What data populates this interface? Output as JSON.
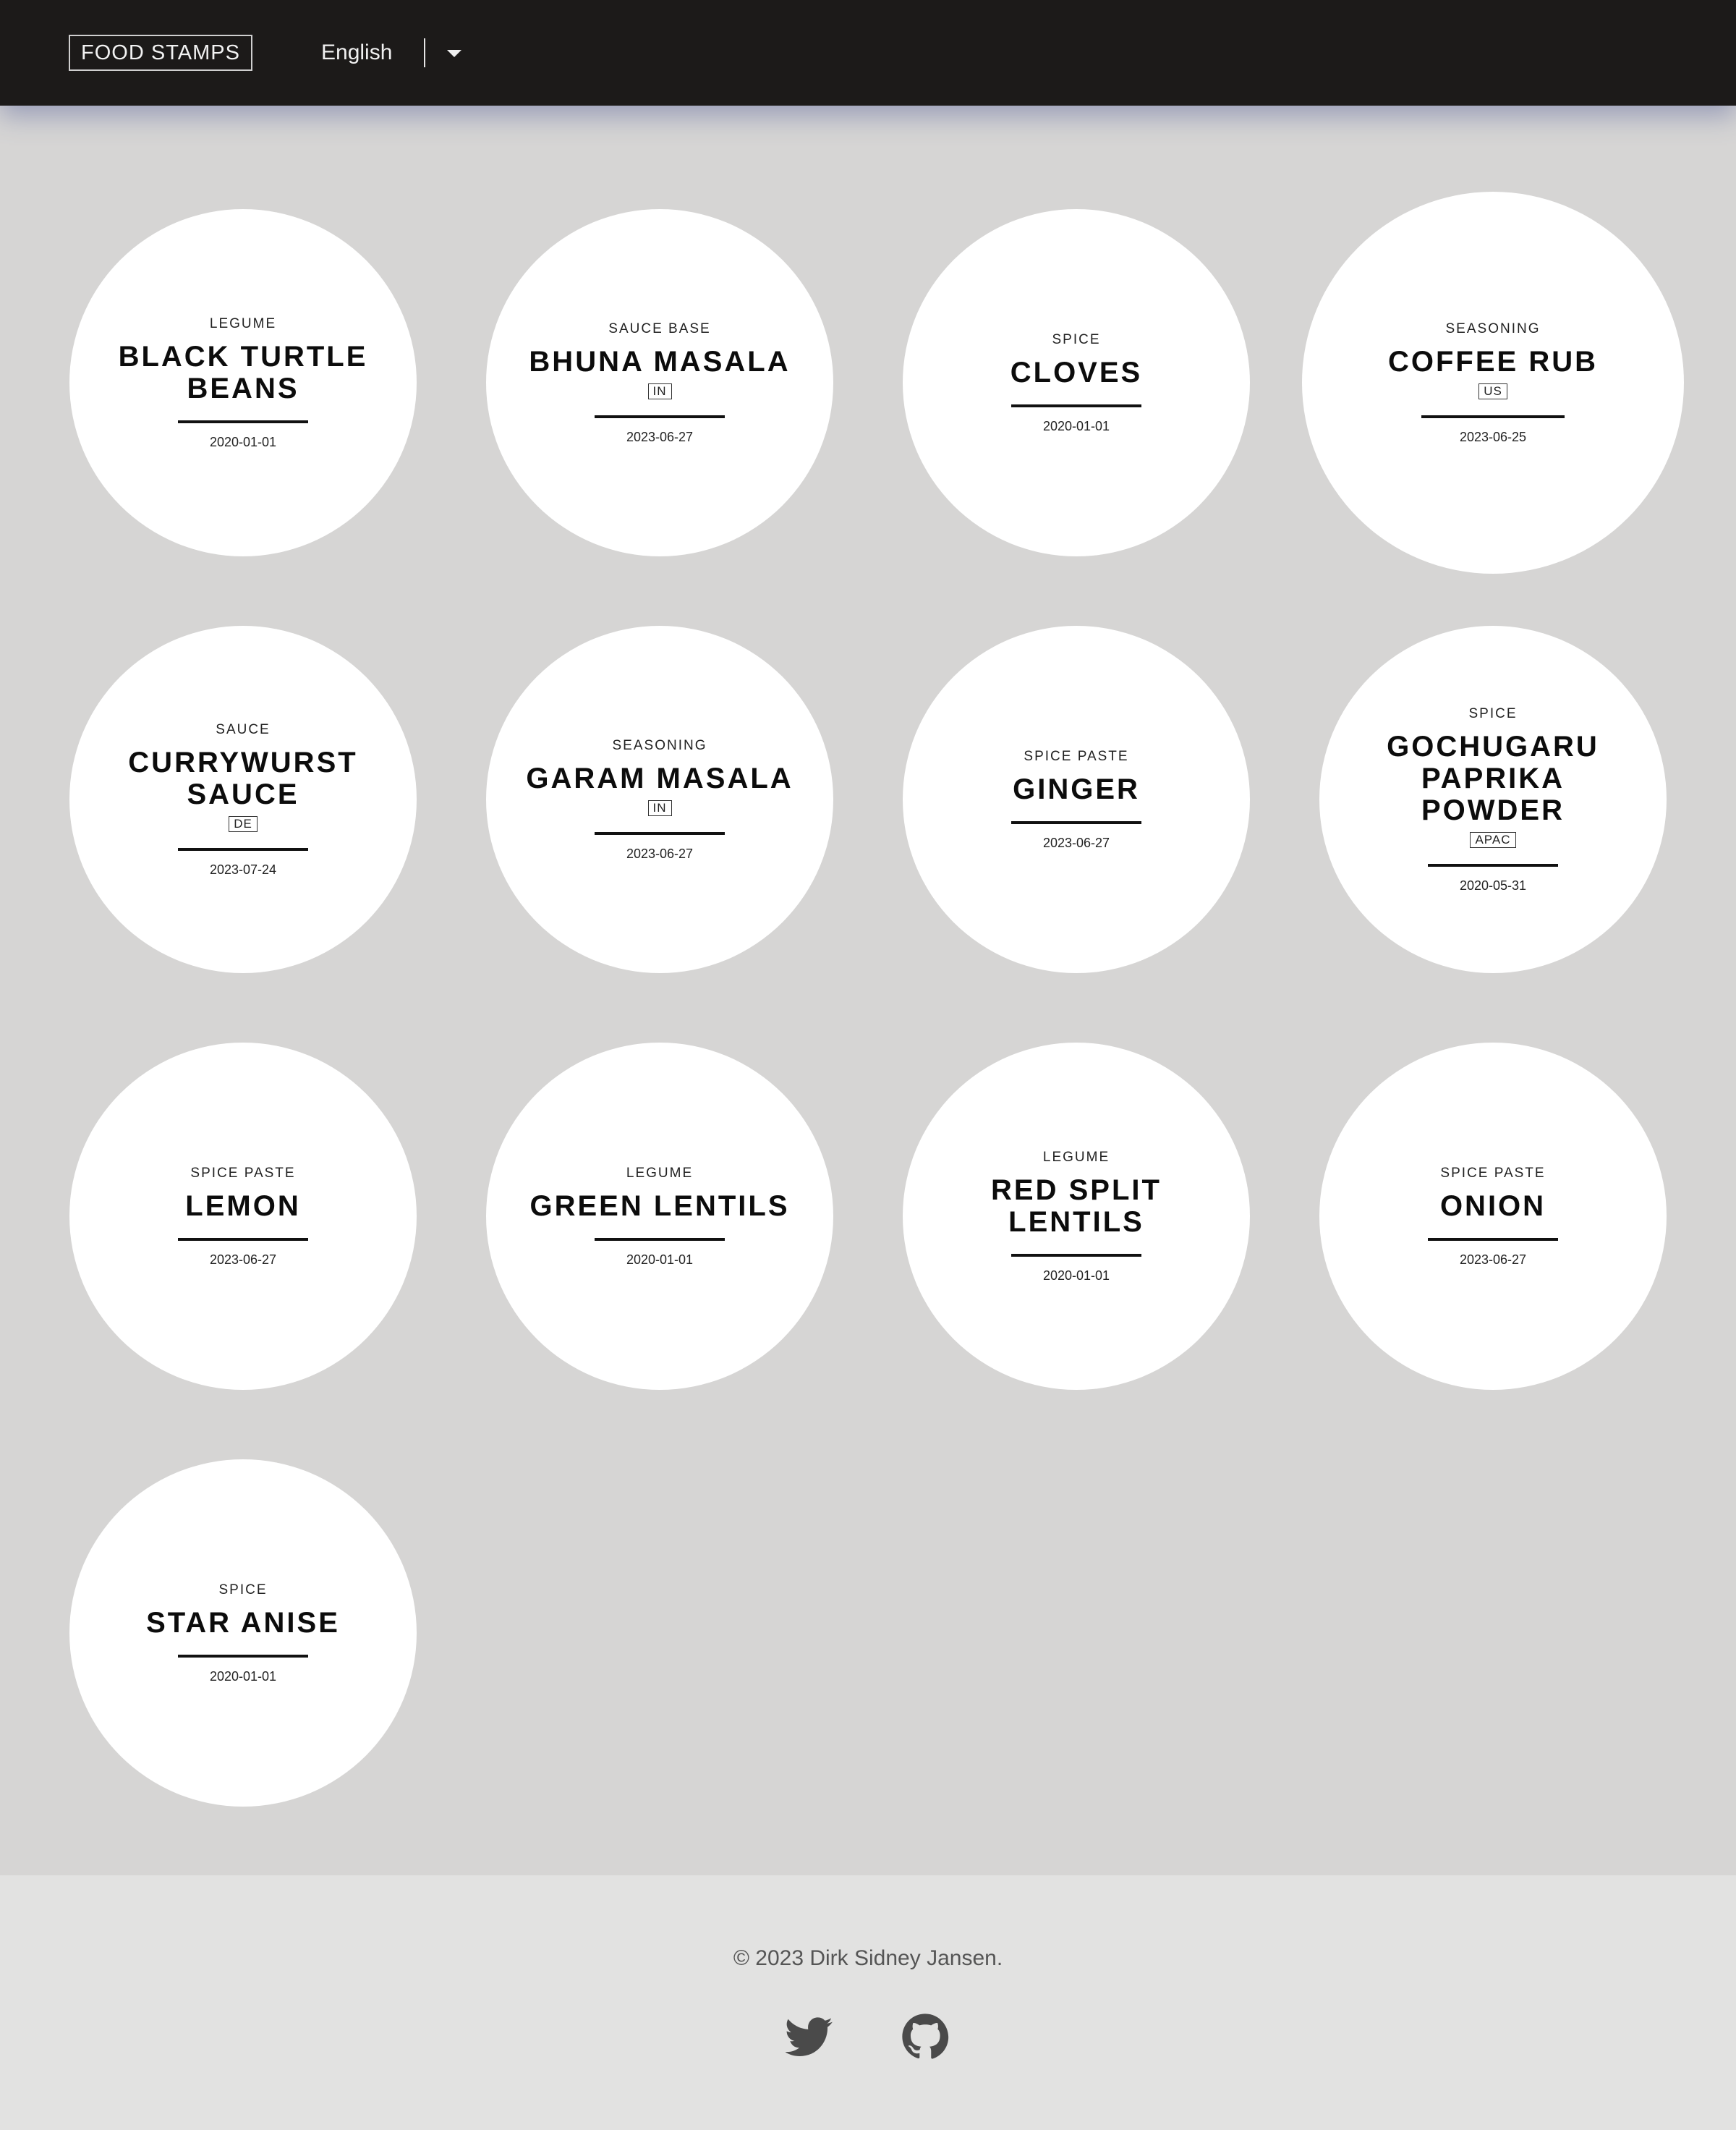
{
  "header": {
    "brand": "FOOD STAMPS",
    "language": "English"
  },
  "stamps": [
    {
      "category": "LEGUME",
      "name": "BLACK TURTLE BEANS",
      "region": "",
      "date": "2020-01-01"
    },
    {
      "category": "SAUCE BASE",
      "name": "BHUNA MASALA",
      "region": "IN",
      "date": "2023-06-27"
    },
    {
      "category": "SPICE",
      "name": "CLOVES",
      "region": "",
      "date": "2020-01-01"
    },
    {
      "category": "SEASONING",
      "name": "COFFEE RUB",
      "region": "US",
      "date": "2023-06-25"
    },
    {
      "category": "SAUCE",
      "name": "CURRYWURST SAUCE",
      "region": "DE",
      "date": "2023-07-24"
    },
    {
      "category": "SEASONING",
      "name": "GARAM MASALA",
      "region": "IN",
      "date": "2023-06-27"
    },
    {
      "category": "SPICE PASTE",
      "name": "GINGER",
      "region": "",
      "date": "2023-06-27"
    },
    {
      "category": "SPICE",
      "name": "GOCHUGARU PAPRIKA POWDER",
      "region": "APAC",
      "date": "2020-05-31"
    },
    {
      "category": "SPICE PASTE",
      "name": "LEMON",
      "region": "",
      "date": "2023-06-27"
    },
    {
      "category": "LEGUME",
      "name": "GREEN LENTILS",
      "region": "",
      "date": "2020-01-01"
    },
    {
      "category": "LEGUME",
      "name": "RED SPLIT LENTILS",
      "region": "",
      "date": "2020-01-01"
    },
    {
      "category": "SPICE PASTE",
      "name": "ONION",
      "region": "",
      "date": "2023-06-27"
    },
    {
      "category": "SPICE",
      "name": "STAR ANISE",
      "region": "",
      "date": "2020-01-01"
    }
  ],
  "footer": {
    "copyright": "© 2023 Dirk Sidney Jansen.",
    "social": [
      {
        "icon": "twitter-icon"
      },
      {
        "icon": "github-icon"
      }
    ]
  }
}
